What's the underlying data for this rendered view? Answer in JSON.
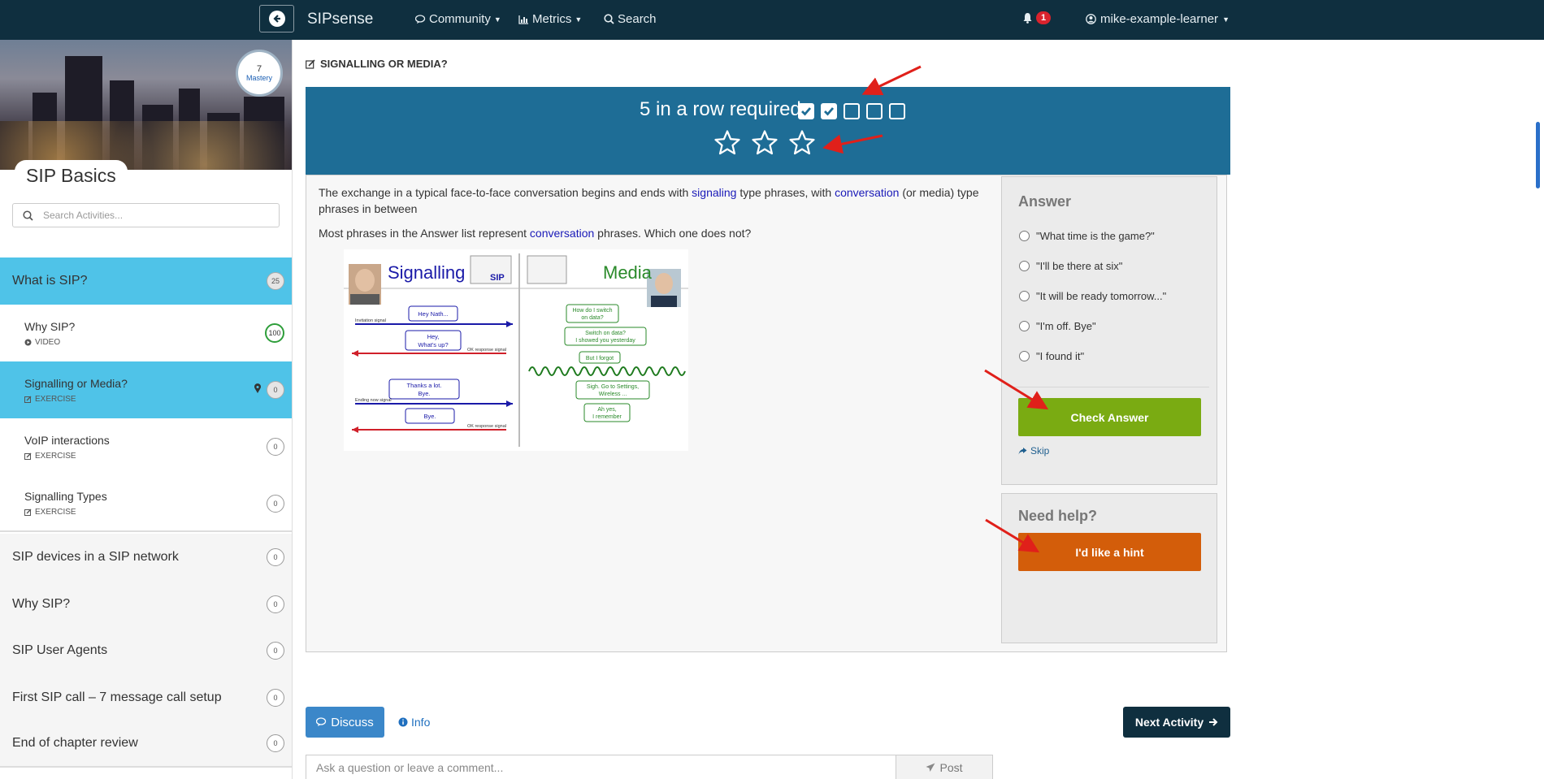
{
  "navbar": {
    "brand": "SIPsense",
    "community": "Community",
    "metrics": "Metrics",
    "search": "Search",
    "notifications": "1",
    "user": "mike-example-learner"
  },
  "sidebar": {
    "mastery_value": "7",
    "mastery_label": "Mastery",
    "course_title": "SIP Basics",
    "search_placeholder": "Search Activities...",
    "sections": [
      {
        "label": "What is SIP?",
        "count": "25"
      },
      {
        "label": "SIP devices in a SIP network",
        "count": "0"
      },
      {
        "label": "Why SIP?",
        "count": "0"
      },
      {
        "label": "SIP User Agents",
        "count": "0"
      },
      {
        "label": "First SIP call – 7 message call setup",
        "count": "0"
      },
      {
        "label": "End of chapter review",
        "count": "0"
      }
    ],
    "activities": [
      {
        "label": "Why SIP?",
        "type": "VIDEO",
        "count": "100"
      },
      {
        "label": "Signalling or Media?",
        "type": "EXERCISE",
        "count": "0"
      },
      {
        "label": "VoIP interactions",
        "type": "EXERCISE",
        "count": "0"
      },
      {
        "label": "Signalling Types",
        "type": "EXERCISE",
        "count": "0"
      }
    ]
  },
  "activity": {
    "title": "SIGNALLING OR MEDIA?",
    "streak_text": "5 in a row required",
    "streak_required": 5,
    "streak_done": 2,
    "stars": 3,
    "q1_a": "The exchange in a typical face-to-face conversation begins and ends with ",
    "q1_kw1": "signaling",
    "q1_b": " type phrases, with ",
    "q1_kw2": "conversation",
    "q1_c": " (or media) type phrases in between",
    "q2_a": "Most phrases in the Answer list represent ",
    "q2_kw": "conversation",
    "q2_b": " phrases. Which one does not?"
  },
  "diagram": {
    "signalling": "Signalling",
    "sip": "SIP",
    "media": "Media",
    "b1": "Hey Nath...",
    "b2a": "Hey,",
    "b2b": "What's up?",
    "b3a": "Thanks a lot.",
    "b3b": "Bye.",
    "b4": "Bye.",
    "m1a": "How do I switch",
    "m1b": "on data?",
    "m2a": "Switch on data?",
    "m2b": "I showed you yesterday",
    "m3": "But I forgot",
    "m4a": "Sigh. Go to Settings,",
    "m4b": "Wireless ...",
    "m5a": "Ah yes,",
    "m5b": "I remember",
    "a1": "Invitation signal",
    "a2": "OK response signal",
    "a3": "Ending now signal",
    "a4": "OK response signal"
  },
  "answer": {
    "title": "Answer",
    "options": [
      "\"What time is the game?\"",
      "\"I'll be there at six\"",
      "\"It will be ready tomorrow...\"",
      "\"I'm off. Bye\"",
      "\"I found it\""
    ],
    "check_button": "Check Answer",
    "skip": "Skip"
  },
  "help": {
    "title": "Need help?",
    "hint_button": "I'd like a hint"
  },
  "footer": {
    "discuss": "Discuss",
    "info": "Info",
    "next": "Next Activity",
    "comment_placeholder": "Ask a question or leave a comment...",
    "post": "Post"
  },
  "colors": {
    "navbar": "#0f2f3f",
    "band": "#1e6d96",
    "active_item": "#4fc3e8",
    "check": "#7aab12",
    "hint": "#d35d0a",
    "arrow": "#e0201a"
  }
}
